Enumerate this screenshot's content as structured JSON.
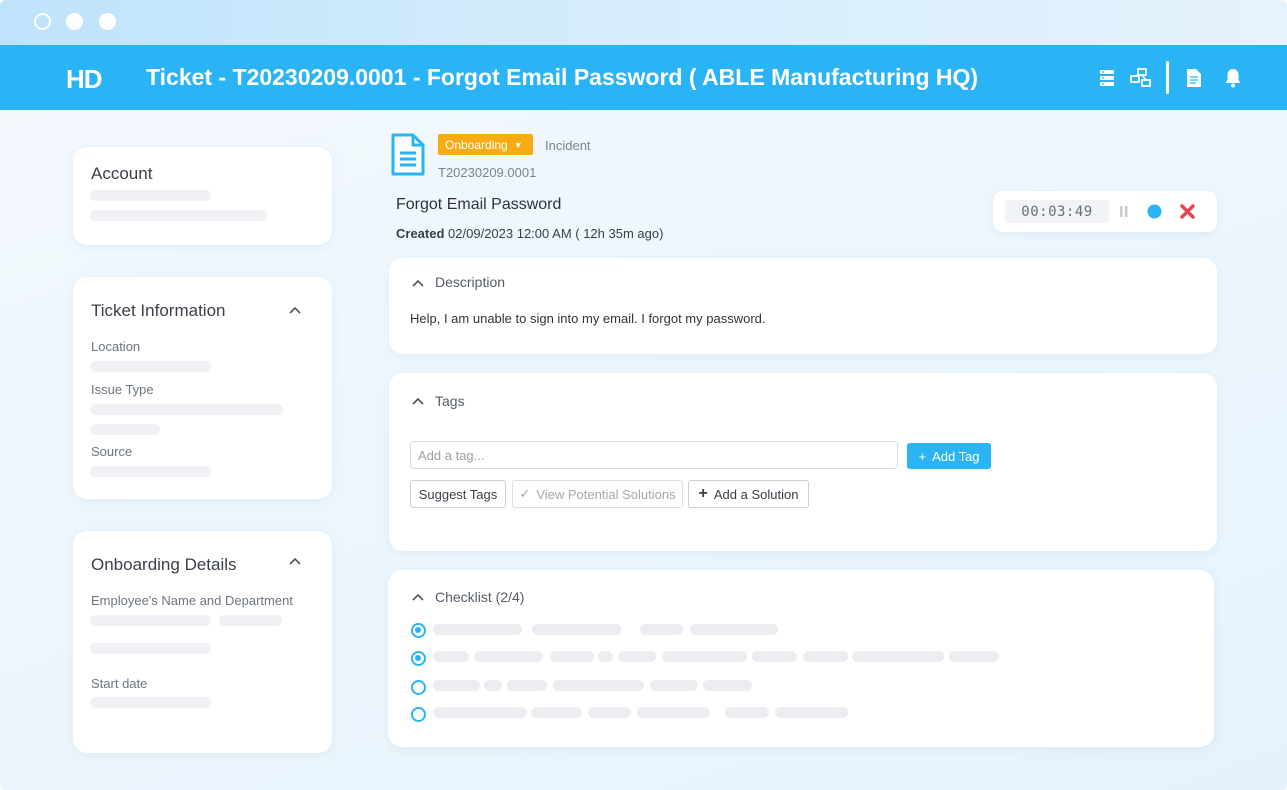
{
  "app": {
    "logo": "HD",
    "title": "Ticket - T20230209.0001 - Forgot Email Password ( ABLE Manufacturing HQ)"
  },
  "sidebar": {
    "account": {
      "title": "Account"
    },
    "ticket_info": {
      "title": "Ticket Information",
      "fields": [
        "Location",
        "Issue Type",
        "Source"
      ]
    },
    "onboarding": {
      "title": "Onboarding Details",
      "fields": [
        "Employee's Name and Department",
        "Start date"
      ]
    }
  },
  "ticket": {
    "queue": "Onboarding",
    "type": "Incident",
    "number": "T20230209.0001",
    "subject": "Forgot Email Password",
    "created_label": "Created",
    "created_value": "02/09/2023 12:00 AM ( 12h 35m ago)"
  },
  "timer": {
    "value": "00:03:49"
  },
  "description": {
    "title": "Description",
    "text": "Help, I am unable to sign into my email. I forgot my password."
  },
  "tags": {
    "title": "Tags",
    "input_placeholder": "Add a tag...",
    "add_button": "Add Tag",
    "suggest_button": "Suggest Tags",
    "view_solutions_button": "View Potential Solutions",
    "add_solution_button": "Add a Solution"
  },
  "checklist": {
    "title": "Checklist (2/4)",
    "items_checked": [
      true,
      true,
      false,
      false
    ]
  },
  "colors": {
    "accent": "#2ab4f5",
    "badge": "#f8ab15",
    "stop": "#e8454f"
  }
}
